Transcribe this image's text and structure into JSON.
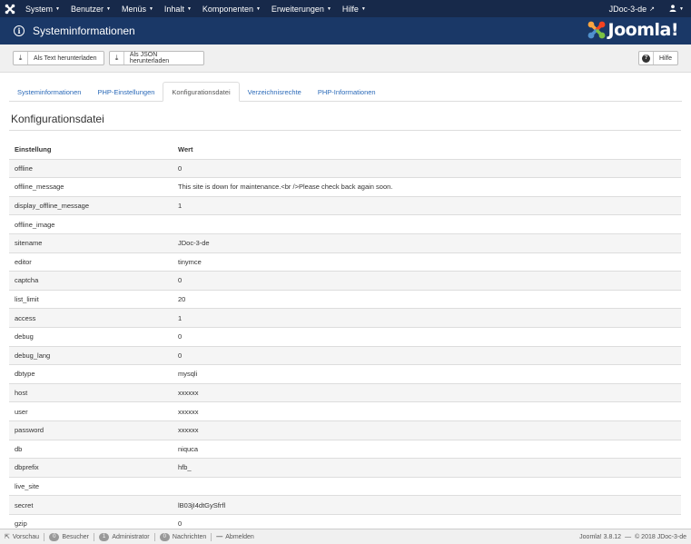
{
  "navbar": {
    "menu": [
      {
        "label": "System"
      },
      {
        "label": "Benutzer"
      },
      {
        "label": "Menüs"
      },
      {
        "label": "Inhalt"
      },
      {
        "label": "Komponenten"
      },
      {
        "label": "Erweiterungen"
      },
      {
        "label": "Hilfe"
      }
    ],
    "site_link": "JDoc-3-de",
    "user_icon": "user-icon"
  },
  "header": {
    "icon": "info-icon",
    "title": "Systeminformationen",
    "brand": "Joomla!"
  },
  "toolbar": {
    "download_text_label": "Als Text herunterladen",
    "download_json_label": "Als JSON herunterladen",
    "help_label": "Hilfe"
  },
  "tabs": [
    {
      "label": "Systeminformationen"
    },
    {
      "label": "PHP-Einstellungen"
    },
    {
      "label": "Konfigurationsdatei"
    },
    {
      "label": "Verzeichnisrechte"
    },
    {
      "label": "PHP-Informationen"
    }
  ],
  "active_tab": "Konfigurationsdatei",
  "section": {
    "title": "Konfigurationsdatei"
  },
  "table": {
    "headers": [
      "Einstellung",
      "Wert"
    ],
    "rows": [
      [
        "offline",
        "0"
      ],
      [
        "offline_message",
        "This site is down for maintenance.<br />Please check back again soon."
      ],
      [
        "display_offline_message",
        "1"
      ],
      [
        "offline_image",
        ""
      ],
      [
        "sitename",
        "JDoc-3-de"
      ],
      [
        "editor",
        "tinymce"
      ],
      [
        "captcha",
        "0"
      ],
      [
        "list_limit",
        "20"
      ],
      [
        "access",
        "1"
      ],
      [
        "debug",
        "0"
      ],
      [
        "debug_lang",
        "0"
      ],
      [
        "dbtype",
        "mysqli"
      ],
      [
        "host",
        "xxxxxx"
      ],
      [
        "user",
        "xxxxxx"
      ],
      [
        "password",
        "xxxxxx"
      ],
      [
        "db",
        "niquca"
      ],
      [
        "dbprefix",
        "hfb_"
      ],
      [
        "live_site",
        ""
      ],
      [
        "secret",
        "lB03jI4dtGySfrfl"
      ],
      [
        "gzip",
        "0"
      ]
    ]
  },
  "statusbar": {
    "preview_label": "Vorschau",
    "visitors_count": "0",
    "visitors_label": "Besucher",
    "admins_count": "1",
    "admins_label": "Administrator",
    "messages_count": "0",
    "messages_label": "Nachrichten",
    "logout_label": "Abmelden",
    "version": "Joomla! 3.8.12",
    "dash": "—",
    "copyright": "© 2018 JDoc-3-de"
  },
  "colors": {
    "navbar_bg": "#17294a",
    "header_bg": "#1a3867",
    "link": "#2a69b8"
  }
}
